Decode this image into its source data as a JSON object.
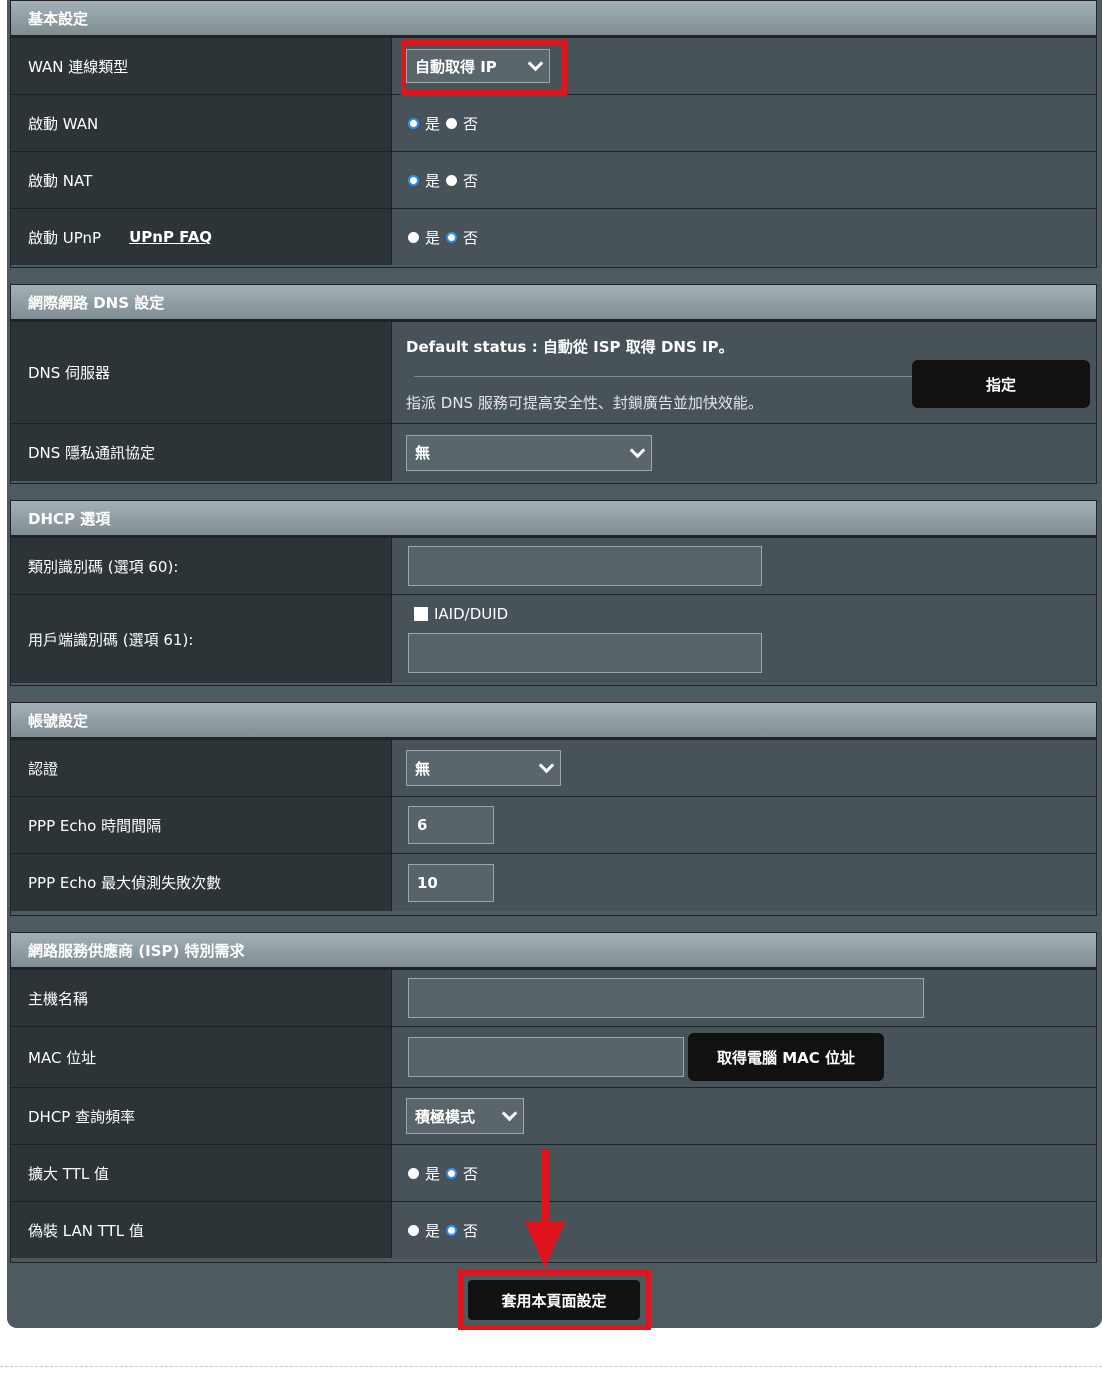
{
  "basic": {
    "header": "基本設定",
    "wan_type_label": "WAN 連線類型",
    "wan_type_value": "自動取得 IP",
    "enable_wan_label": "啟動 WAN",
    "enable_nat_label": "啟動 NAT",
    "enable_upnp_label": "啟動 UPnP",
    "upnp_faq_link": "UPnP FAQ",
    "yes": "是",
    "no": "否"
  },
  "dns": {
    "header": "網際網路 DNS 設定",
    "server_label": "DNS 伺服器",
    "default_status": "Default status : 自動從 ISP 取得 DNS IP。",
    "hint": "指派 DNS 服務可提高安全性、封鎖廣告並加快效能。",
    "assign_button": "指定",
    "privacy_label": "DNS 隱私通訊協定",
    "privacy_value": "無"
  },
  "dhcp": {
    "header": "DHCP 選項",
    "class_id_label": "類別識別碼 (選項 60):",
    "class_id_value": "",
    "client_id_label": "用戶端識別碼 (選項 61):",
    "iaid_duid_label": "IAID/DUID",
    "client_id_value": ""
  },
  "account": {
    "header": "帳號設定",
    "auth_label": "認證",
    "auth_value": "無",
    "echo_interval_label": "PPP Echo 時間間隔",
    "echo_interval_value": "6",
    "echo_max_fail_label": "PPP Echo 最大偵測失敗次數",
    "echo_max_fail_value": "10"
  },
  "isp": {
    "header": "網路服務供應商 (ISP) 特別需求",
    "hostname_label": "主機名稱",
    "hostname_value": "",
    "mac_label": "MAC 位址",
    "mac_value": "",
    "mac_button": "取得電腦 MAC 位址",
    "dhcp_query_label": "DHCP 查詢頻率",
    "dhcp_query_value": "積極模式",
    "extend_ttl_label": "擴大 TTL 值",
    "spoof_ttl_label": "偽裝 LAN TTL 值"
  },
  "apply_button": "套用本頁面設定",
  "colors": {
    "highlight": "#e0141c",
    "radio_selected": "#2e8cf5"
  }
}
